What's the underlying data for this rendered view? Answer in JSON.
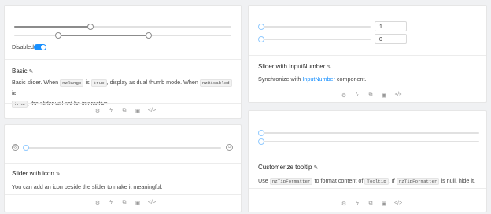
{
  "cards": {
    "basic": {
      "disabled_label": "Disabled:",
      "title": "Basic",
      "desc_part1": "Basic slider. When ",
      "code_range": "nzRange",
      "desc_is": " is ",
      "code_true": "true",
      "desc_part2": ", display as dual thumb mode. When ",
      "code_disabled": "nzDisabled",
      "desc_is2": " is",
      "code_true2": "true",
      "desc_part3": ", the slider will not be interactive."
    },
    "input_number": {
      "title": "Slider with InputNumber",
      "value1": "1",
      "value2": "0",
      "desc_part1": "Synchronize with ",
      "desc_link": "InputNumber",
      "desc_part2": " component."
    },
    "icon": {
      "title": "Slider with icon",
      "desc": "You can add an icon beside the slider to make it meaningful."
    },
    "tooltip": {
      "title": "Customerize tooltip",
      "desc_use": "Use ",
      "code_formatter": "nzTipFormatter",
      "desc_mid": " to format content of ",
      "code_tooltip": "Tooltip",
      "desc_if": ". If ",
      "code_formatter2": "nzTipFormatter",
      "desc_end": " is null, hide it."
    }
  },
  "toolbar_icons": [
    "bug-icon",
    "lightning-icon",
    "copy-icon",
    "expand-icon",
    "code-icon"
  ],
  "colors": {
    "accent": "#1890ff",
    "handle_blue": "#91caff"
  }
}
